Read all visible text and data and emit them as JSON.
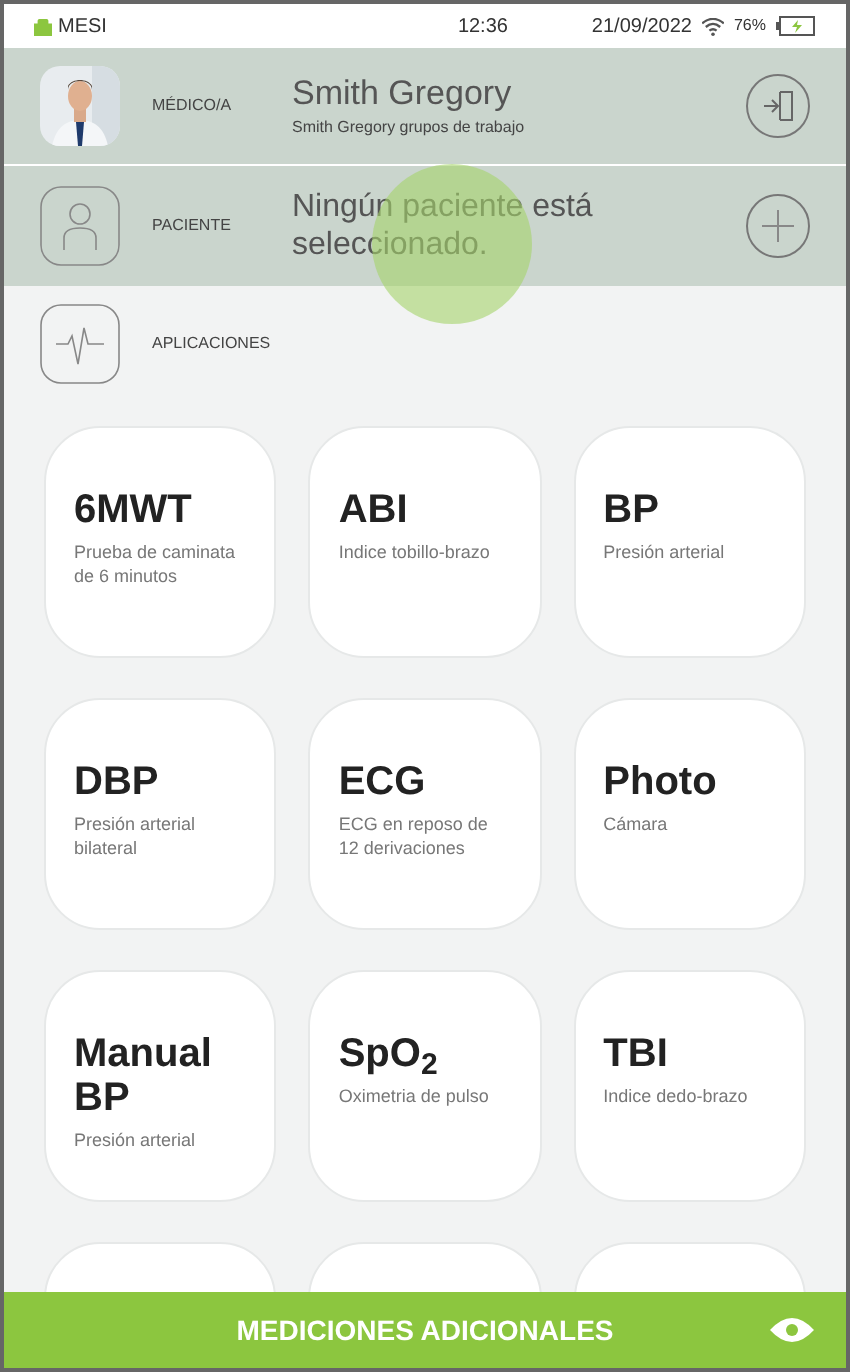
{
  "status_bar": {
    "brand": "MESI",
    "time": "12:36",
    "date": "21/09/2022",
    "battery": "76%"
  },
  "doctor": {
    "label": "MÉDICO/A",
    "name": "Smith Gregory",
    "group": "Smith Gregory grupos de trabajo"
  },
  "patient": {
    "label": "PACIENTE",
    "message": "Ningún paciente está seleccionado."
  },
  "applications": {
    "label": "APLICACIONES"
  },
  "apps": [
    {
      "title": "6MWT",
      "subtitle": "Prueba de caminata de 6 minutos"
    },
    {
      "title": "ABI",
      "subtitle": "Indice tobillo-brazo"
    },
    {
      "title": "BP",
      "subtitle": "Presión arterial"
    },
    {
      "title": "DBP",
      "subtitle": "Presión arterial bilateral"
    },
    {
      "title": "ECG",
      "subtitle": "ECG en reposo de 12 derivaciones"
    },
    {
      "title": "Photo",
      "subtitle": "Cámara"
    },
    {
      "title": "Manual BP",
      "subtitle": "Presión arterial"
    },
    {
      "title": "SpO$_{2}$",
      "subtitle": "Oximetria de pulso"
    },
    {
      "title": "TBI",
      "subtitle": "Indice dedo-brazo"
    }
  ],
  "footer": {
    "label": "MEDICIONES ADICIONALES"
  }
}
